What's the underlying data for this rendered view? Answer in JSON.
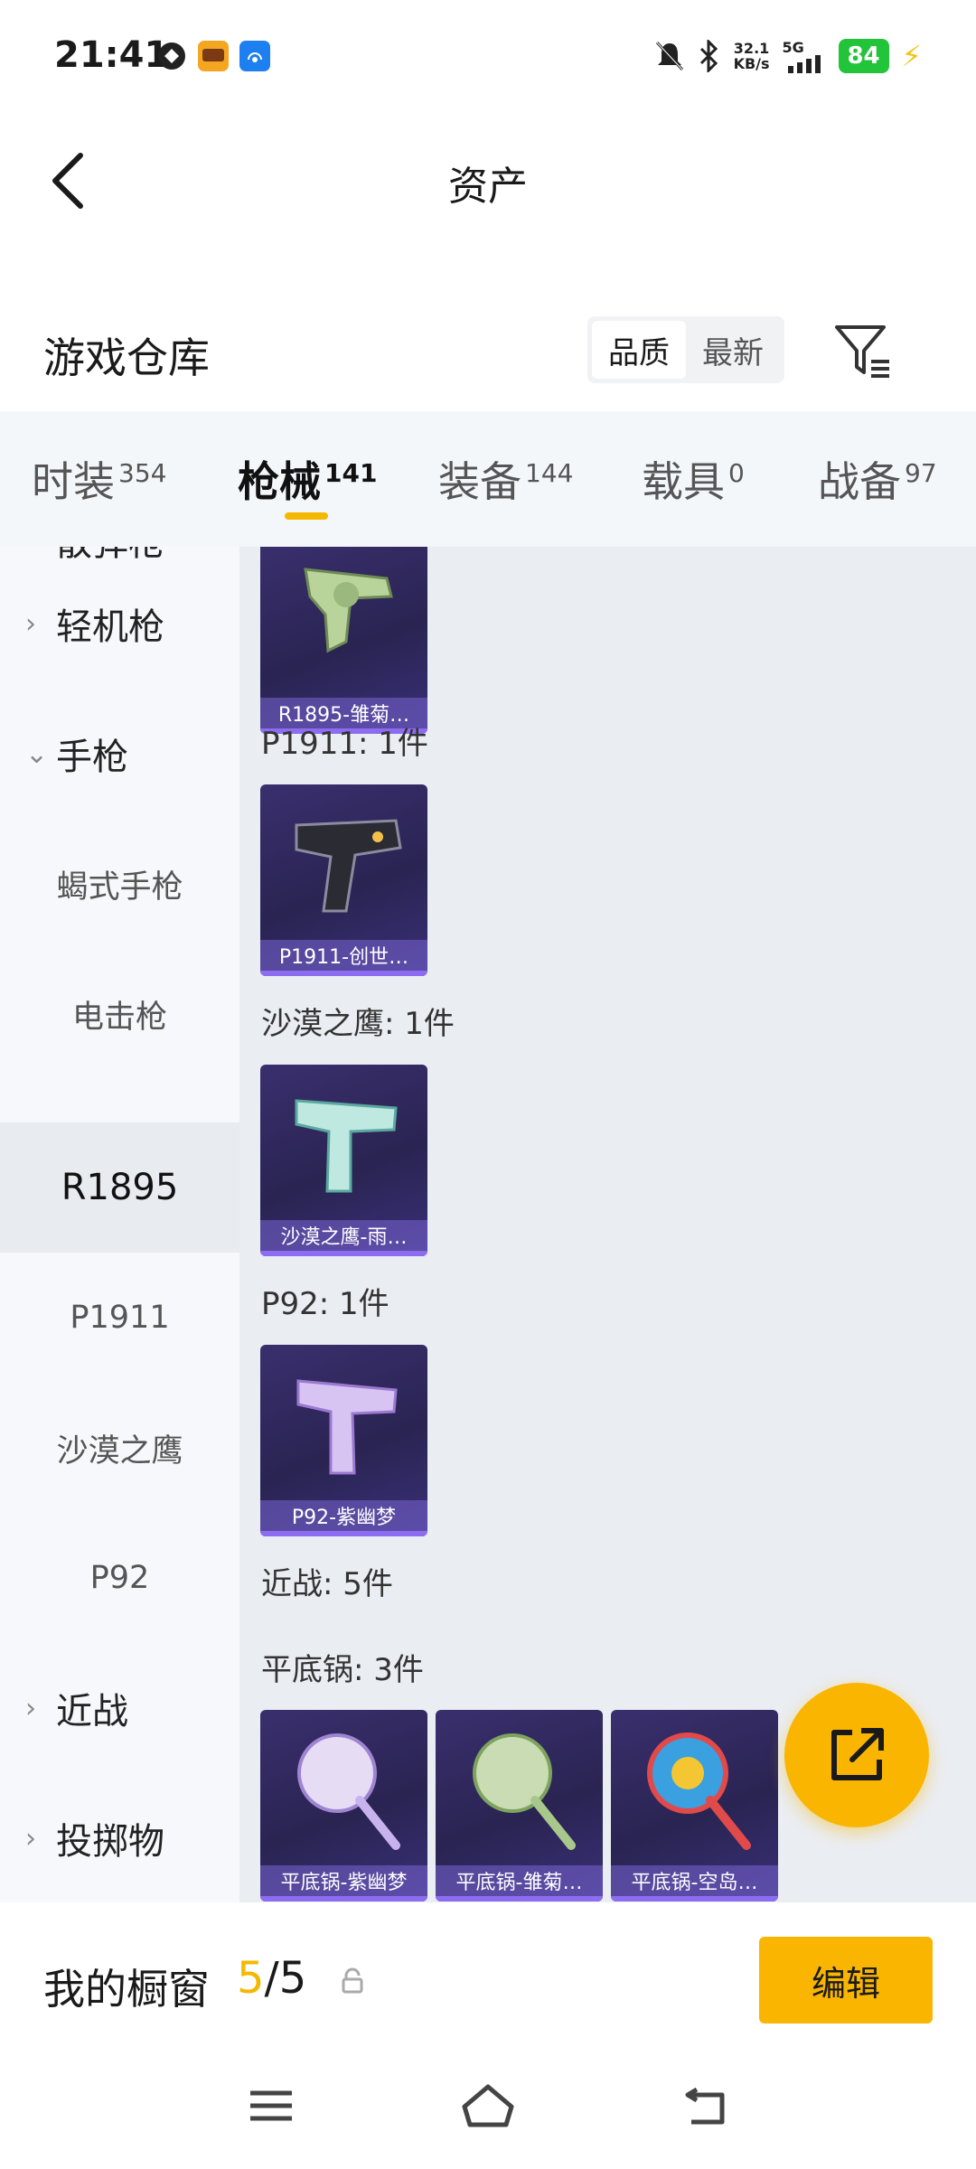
{
  "status_bar": {
    "time": "21:41",
    "net_speed_value": "32.1",
    "net_speed_unit": "KB/s",
    "network": "5G",
    "battery": "84",
    "icons": [
      "notifications-muted-icon",
      "bluetooth-icon",
      "signal-icon",
      "charging-icon"
    ]
  },
  "header": {
    "title": "资产",
    "back_icon": "back-arrow-icon"
  },
  "warehouse": {
    "title": "游戏仓库",
    "sort_options": [
      "品质",
      "最新"
    ],
    "active_sort": "品质",
    "filter_icon": "filter-icon"
  },
  "tabs": [
    {
      "label": "时装",
      "count": "354"
    },
    {
      "label": "枪械",
      "count": "141",
      "active": true
    },
    {
      "label": "装备",
      "count": "144"
    },
    {
      "label": "载具",
      "count": "0"
    },
    {
      "label": "战备",
      "count": "97"
    }
  ],
  "sidebar": {
    "top_partial": "散弹枪",
    "items": [
      {
        "label": "轻机枪",
        "type": "group",
        "expanded": false
      },
      {
        "label": "手枪",
        "type": "group",
        "expanded": true
      },
      {
        "label": "蝎式手枪",
        "type": "sub"
      },
      {
        "label": "电击枪",
        "type": "sub"
      },
      {
        "label": "R1895",
        "type": "sub",
        "selected": true
      },
      {
        "label": "P1911",
        "type": "sub"
      },
      {
        "label": "沙漠之鹰",
        "type": "sub"
      },
      {
        "label": "P92",
        "type": "sub"
      },
      {
        "label": "近战",
        "type": "group",
        "expanded": false
      },
      {
        "label": "投掷物",
        "type": "group",
        "expanded": false
      }
    ]
  },
  "content": {
    "sections": [
      {
        "label": "",
        "items": [
          "R1895-雏菊…"
        ]
      },
      {
        "label": "P1911: 1件",
        "items": [
          "P1911-创世…"
        ]
      },
      {
        "label": "沙漠之鹰: 1件",
        "items": [
          "沙漠之鹰-雨…"
        ]
      },
      {
        "label": "P92: 1件",
        "items": [
          "P92-紫幽梦"
        ]
      },
      {
        "label": "近战: 5件",
        "items": []
      },
      {
        "label": "平底锅: 3件",
        "items": [
          "平底锅-紫幽梦",
          "平底锅-雏菊…",
          "平底锅-空岛…"
        ]
      }
    ]
  },
  "fab": {
    "icon": "share-export-icon"
  },
  "showcase": {
    "title": "我的橱窗",
    "count_current": "5",
    "count_sep_total": "/5",
    "lock_icon": "lock-icon",
    "edit_label": "编辑"
  },
  "nav_bar": {
    "icons": [
      "menu-icon",
      "home-icon",
      "back-icon"
    ]
  },
  "colors": {
    "accent": "#f9b500",
    "tab_bg": "#f4f7fa",
    "content_bg": "#eaedf2",
    "card_bg": "#2a2452"
  }
}
